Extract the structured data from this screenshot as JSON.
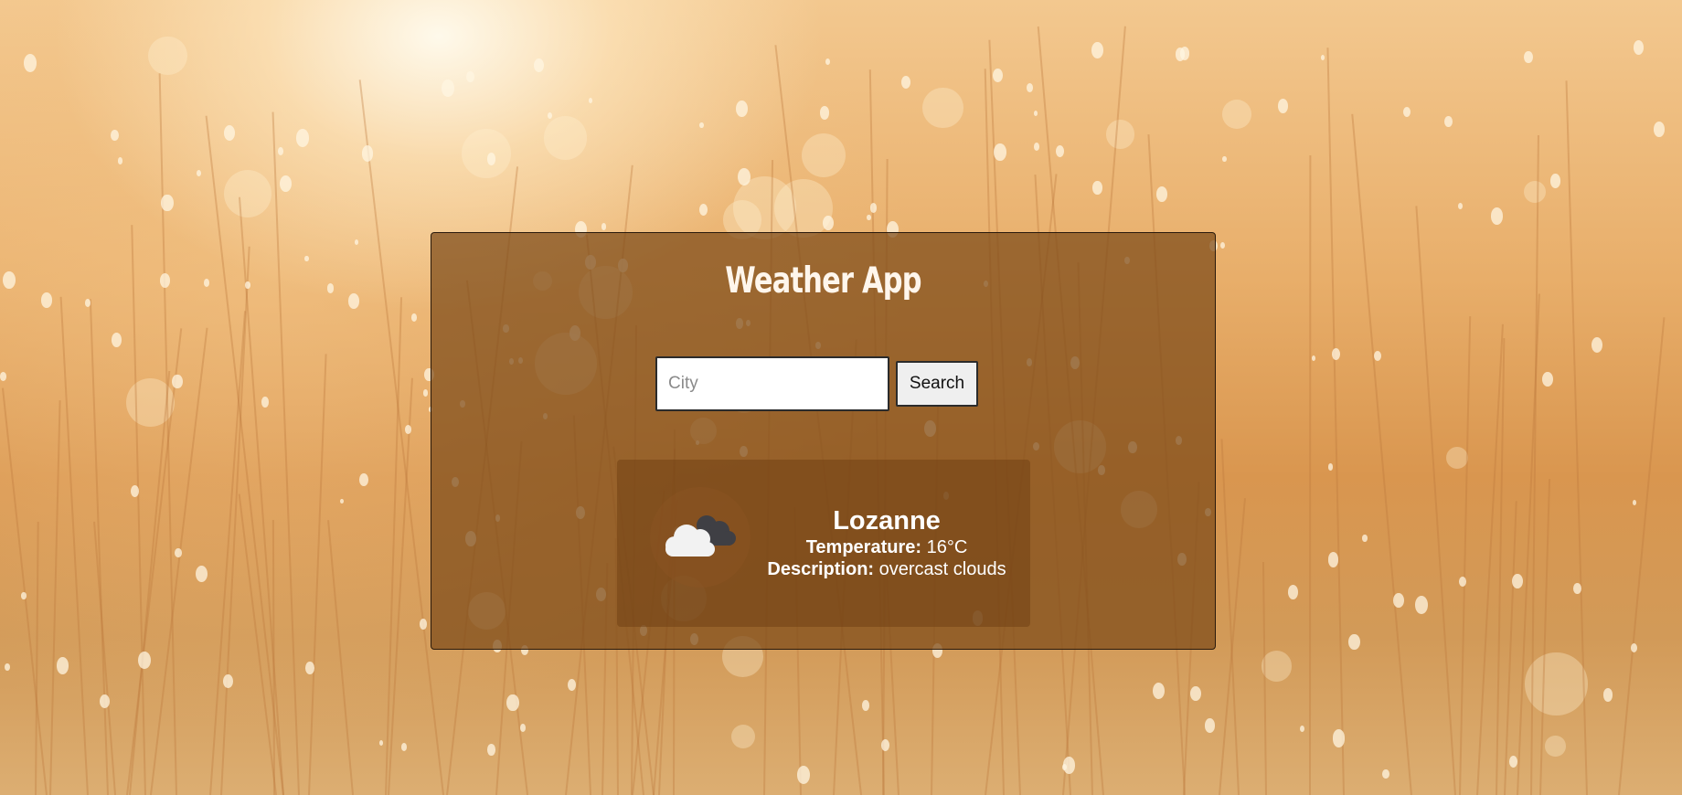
{
  "app": {
    "title": "Weather App"
  },
  "search": {
    "placeholder": "City",
    "value": "",
    "button_label": "Search"
  },
  "weather": {
    "city": "Lozanne",
    "temperature_label": "Temperature:",
    "temperature_value": "16°C",
    "description_label": "Description:",
    "description_value": "overcast clouds",
    "icon": "overcast-clouds-icon"
  },
  "colors": {
    "card_background": "#7d4b19",
    "text": "#ffffff",
    "button_background": "#efefef"
  }
}
